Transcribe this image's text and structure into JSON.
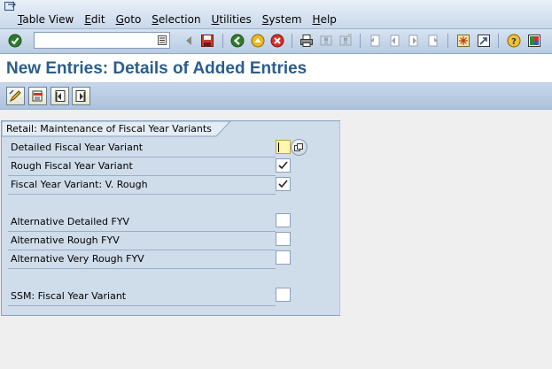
{
  "menu": {
    "items": [
      {
        "label": "Table View",
        "underline": "T",
        "rest": "able View"
      },
      {
        "label": "Edit",
        "underline": "E",
        "rest": "dit"
      },
      {
        "label": "Goto",
        "underline": "G",
        "rest": "oto"
      },
      {
        "label": "Selection",
        "underline": "S",
        "rest": "election"
      },
      {
        "label": "Utilities",
        "underline": "U",
        "rest": "tilities"
      },
      {
        "label": "System",
        "underline": "S",
        "rest": "ystem"
      },
      {
        "label": "Help",
        "underline": "H",
        "rest": "elp"
      }
    ]
  },
  "toolbar": {
    "command_field_value": "",
    "icons": [
      "enter-icon",
      "command-history-icon",
      "back-arrow-icon",
      "save-icon",
      "back-icon",
      "exit-icon",
      "cancel-icon",
      "print-icon",
      "find-icon",
      "find-next-icon",
      "first-page-icon",
      "previous-page-icon",
      "next-page-icon",
      "last-page-icon",
      "create-session-icon",
      "shortcut-icon",
      "help-icon",
      "customize-layout-icon"
    ]
  },
  "page": {
    "title": "New Entries: Details of Added Entries"
  },
  "app_toolbar": {
    "icons": [
      "change-display-icon",
      "delete-icon",
      "previous-entry-icon",
      "next-entry-icon"
    ]
  },
  "group": {
    "title": "Retail: Maintenance of Fiscal Year Variants",
    "fields": [
      {
        "label": "Detailed Fiscal Year Variant",
        "checked": false,
        "required": true
      },
      {
        "label": "Rough Fiscal Year Variant",
        "checked": true
      },
      {
        "label": "Fiscal Year Variant: V. Rough",
        "checked": true
      },
      {
        "label": "Alternative Detailed FYV",
        "checked": false
      },
      {
        "label": "Alternative Rough FYV",
        "checked": false
      },
      {
        "label": "Alternative Very Rough FYV",
        "checked": false
      },
      {
        "label": "SSM: Fiscal Year Variant",
        "checked": false
      }
    ]
  },
  "colors": {
    "title": "#2a5d8e",
    "group_background": "#cfdcea",
    "required_field": "#fff7b0"
  }
}
